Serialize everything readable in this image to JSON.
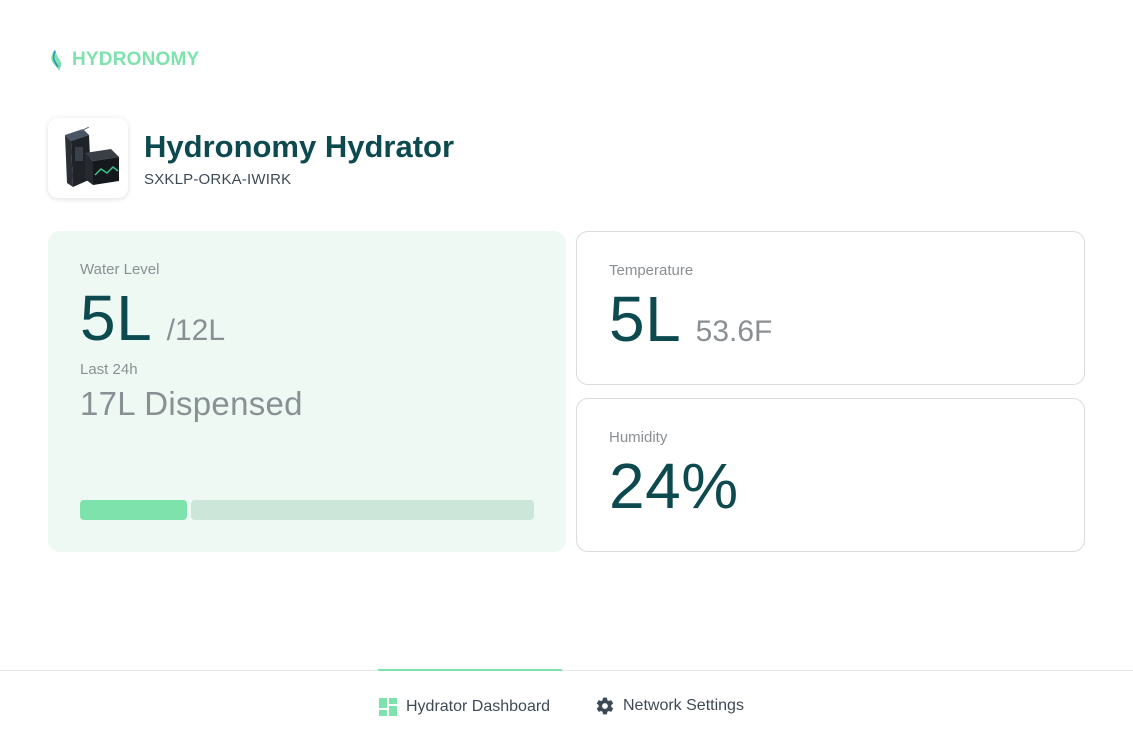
{
  "colors": {
    "brand": "#7ee2ad",
    "dark_teal": "#0d4a4f",
    "muted_text": "#8a8f94",
    "water_card_bg": "#eef9f3",
    "progress_fill": "#7ee2ad",
    "progress_track": "#cde6da",
    "card_border": "#d8dcdf",
    "nav_text": "#3d4a55",
    "tab_indicator": "#7ee2ad",
    "serial_text": "#3d4a55"
  },
  "brand": {
    "name": "HYDRONOMY",
    "icon": "water-drop-leaf-icon"
  },
  "device": {
    "title": "Hydronomy Hydrator",
    "serial": "SXKLP-ORKA-IWIRK",
    "image": "hydrator-device-image"
  },
  "water_level": {
    "label": "Water Level",
    "value": "5L",
    "capacity": "/12L",
    "last_label": "Last 24h",
    "dispensed": "17L Dispensed",
    "fill_fraction": 0.235
  },
  "temperature": {
    "label": "Temperature",
    "value": "5L",
    "sub": "53.6F"
  },
  "humidity": {
    "label": "Humidity",
    "value": "24%"
  },
  "nav": {
    "tabs": [
      {
        "label": "Hydrator Dashboard",
        "icon": "dashboard-grid-icon",
        "active": true
      },
      {
        "label": "Network Settings",
        "icon": "gear-icon",
        "active": false
      }
    ]
  }
}
